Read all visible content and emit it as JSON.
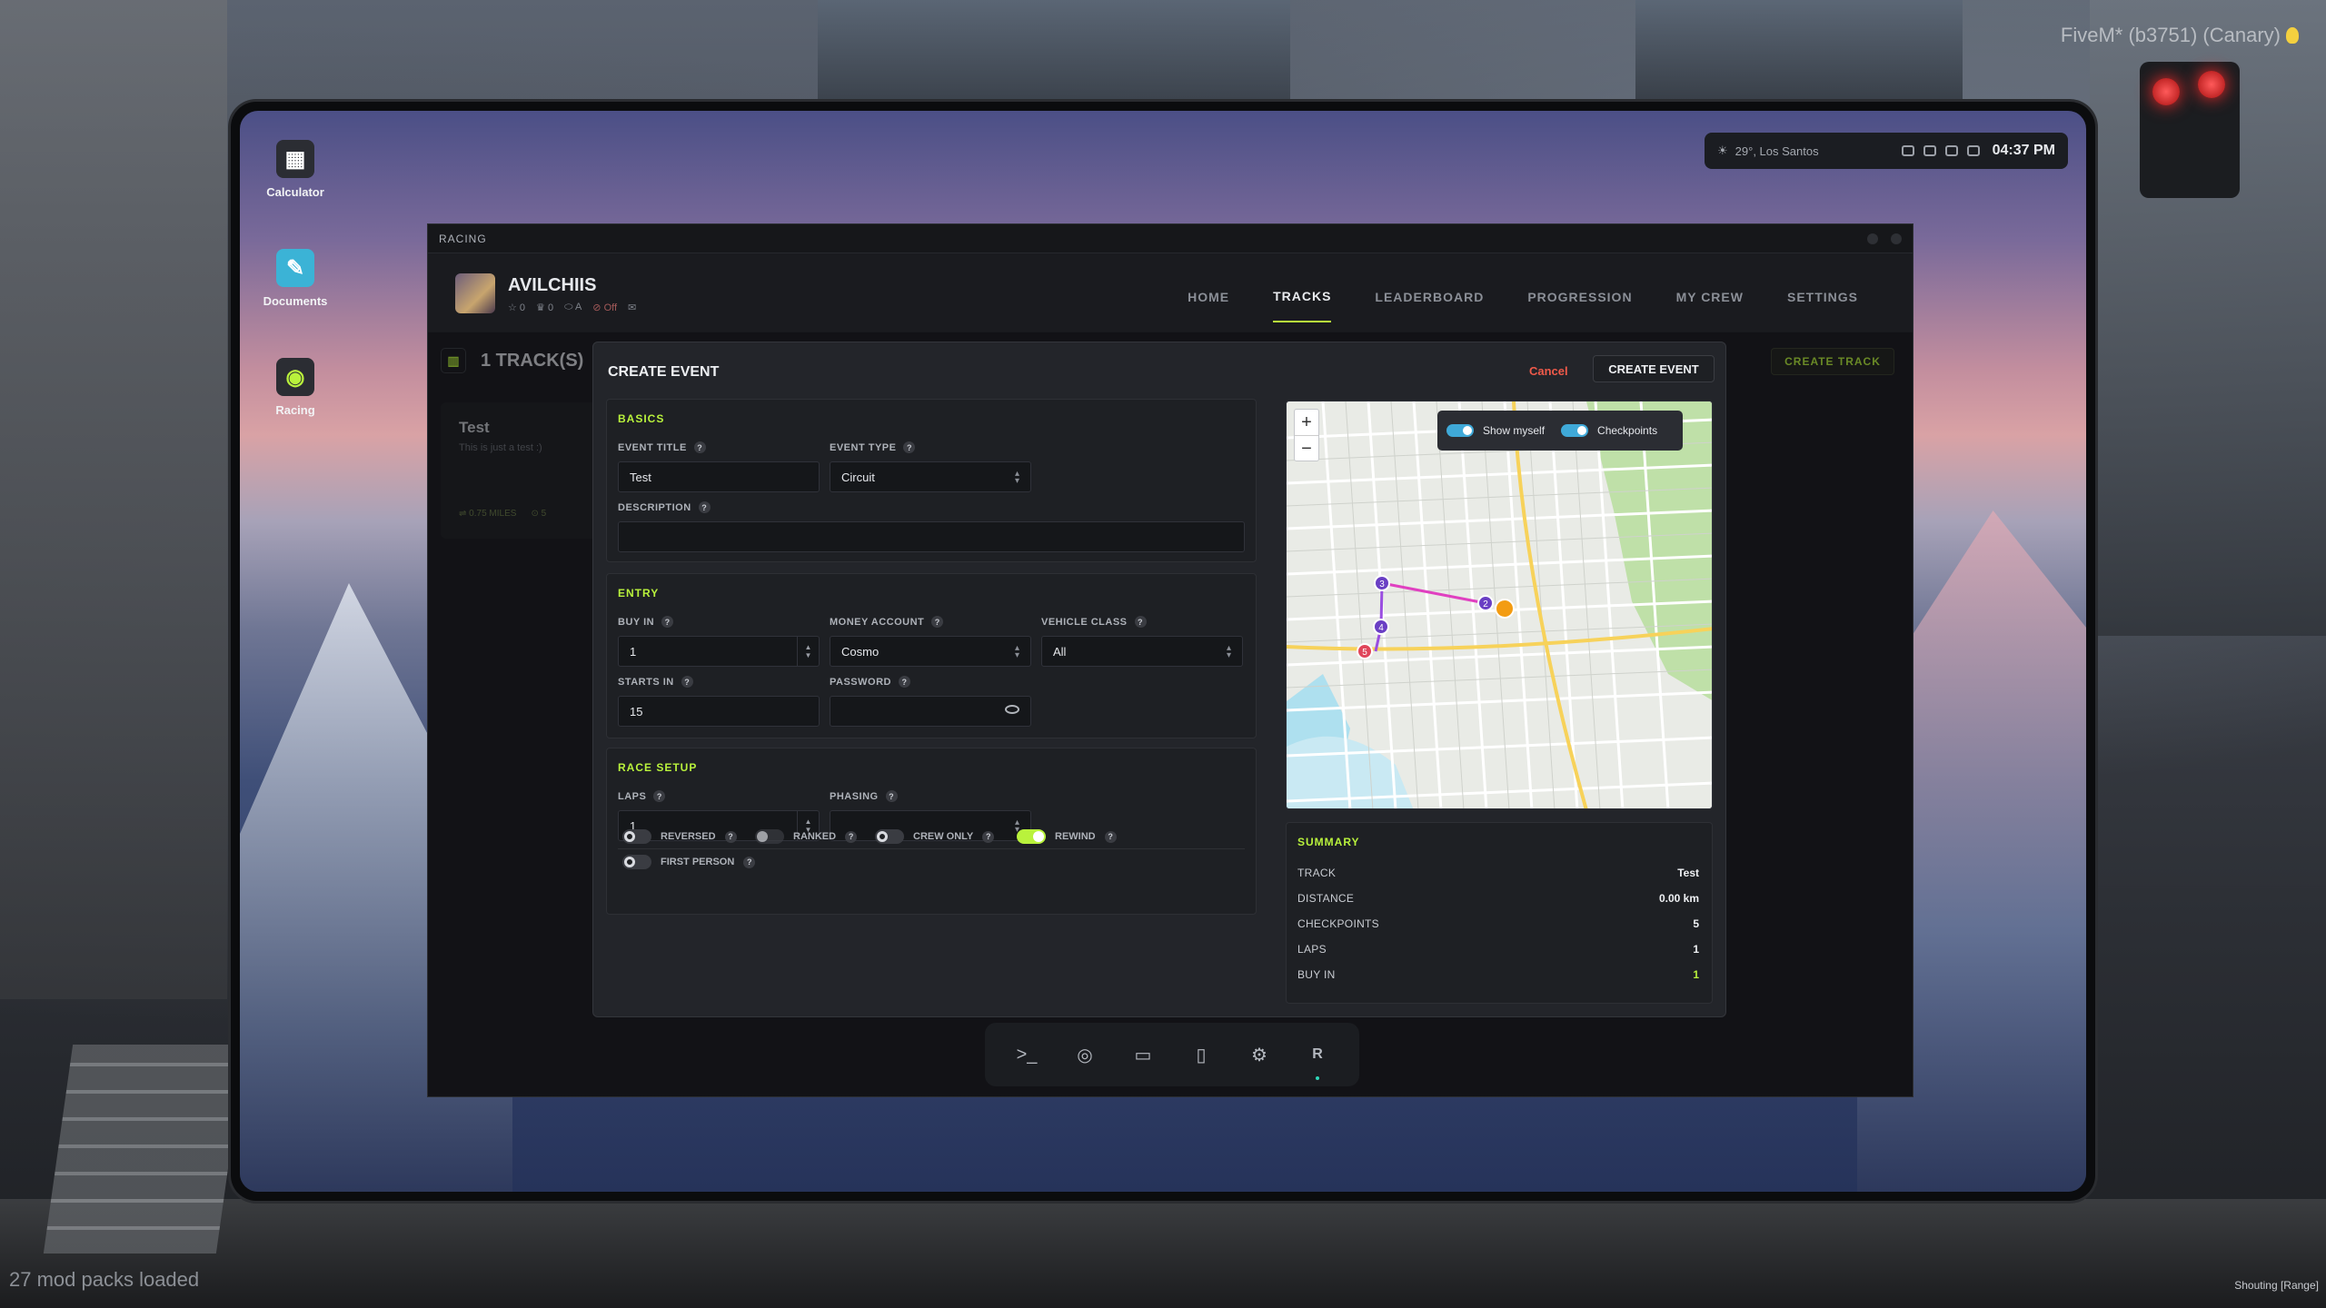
{
  "overlay": {
    "fivem_label": "FiveM* (b3751) (Canary)",
    "mods_loaded": "27 mod packs loaded",
    "voice_range": "Shouting [Range]"
  },
  "statusbar": {
    "weather": "29°, Los Santos",
    "time": "04:37 PM"
  },
  "desktop": {
    "icons": [
      {
        "label": "Calculator",
        "icon": "calculator-icon"
      },
      {
        "label": "Documents",
        "icon": "documents-icon"
      },
      {
        "label": "Racing",
        "icon": "racing-icon"
      }
    ]
  },
  "app": {
    "title": "RACING",
    "profile": {
      "name": "AVILCHIIS",
      "stat_stars": "0",
      "stat_trophies": "0",
      "stat_rank": "A",
      "stat_status": "Off"
    },
    "nav": [
      "HOME",
      "TRACKS",
      "LEADERBOARD",
      "PROGRESSION",
      "MY CREW",
      "SETTINGS"
    ],
    "active_tab": "TRACKS",
    "tracks_count": "1 TRACK(S)",
    "create_track": "CREATE TRACK",
    "track_card": {
      "title": "Test",
      "desc": "This is just a test :)",
      "miles": "0.75 MILES",
      "checkpoints": "5"
    }
  },
  "modal": {
    "title": "CREATE EVENT",
    "cancel": "Cancel",
    "create": "CREATE EVENT",
    "basics": {
      "title": "BASICS",
      "event_title_label": "EVENT TITLE",
      "event_title_value": "Test",
      "event_type_label": "EVENT TYPE",
      "event_type_value": "Circuit",
      "description_label": "DESCRIPTION",
      "description_value": ""
    },
    "entry": {
      "title": "ENTRY",
      "buy_in_label": "BUY IN",
      "buy_in_value": "1",
      "money_account_label": "MONEY ACCOUNT",
      "money_account_value": "Cosmo",
      "vehicle_class_label": "VEHICLE CLASS",
      "vehicle_class_value": "All",
      "starts_in_label": "STARTS IN",
      "starts_in_value": "15",
      "password_label": "PASSWORD",
      "password_value": ""
    },
    "race_setup": {
      "title": "RACE SETUP",
      "laps_label": "LAPS",
      "laps_value": "1",
      "phasing_label": "PHASING",
      "phasing_value": "",
      "toggles": [
        {
          "label": "REVERSED",
          "on": false
        },
        {
          "label": "RANKED",
          "on": false
        },
        {
          "label": "CREW ONLY",
          "on": false
        },
        {
          "label": "REWIND",
          "on": true
        },
        {
          "label": "FIRST PERSON",
          "on": false
        }
      ]
    },
    "map": {
      "zoom_in": "+",
      "zoom_out": "−",
      "show_myself": "Show myself",
      "checkpoints": "Checkpoints",
      "markers": [
        "3",
        "2",
        "4",
        "5"
      ]
    },
    "summary": {
      "title": "SUMMARY",
      "rows": [
        {
          "k": "TRACK",
          "v": "Test"
        },
        {
          "k": "DISTANCE",
          "v": "0.00 km"
        },
        {
          "k": "CHECKPOINTS",
          "v": "5"
        },
        {
          "k": "LAPS",
          "v": "1"
        },
        {
          "k": "BUY IN",
          "v": "1"
        }
      ]
    }
  },
  "dock": {
    "items": [
      "terminal-icon",
      "globe-icon",
      "folder-icon",
      "file-icon",
      "gear-icon",
      "R"
    ]
  },
  "colors": {
    "accent": "#b9f23c",
    "cancel": "#ef5a4a",
    "map_toggle": "#3fa9d8",
    "marker_purple": "#6a3fc4",
    "marker_red": "#e0465a",
    "marker_orange": "#f39c12"
  }
}
